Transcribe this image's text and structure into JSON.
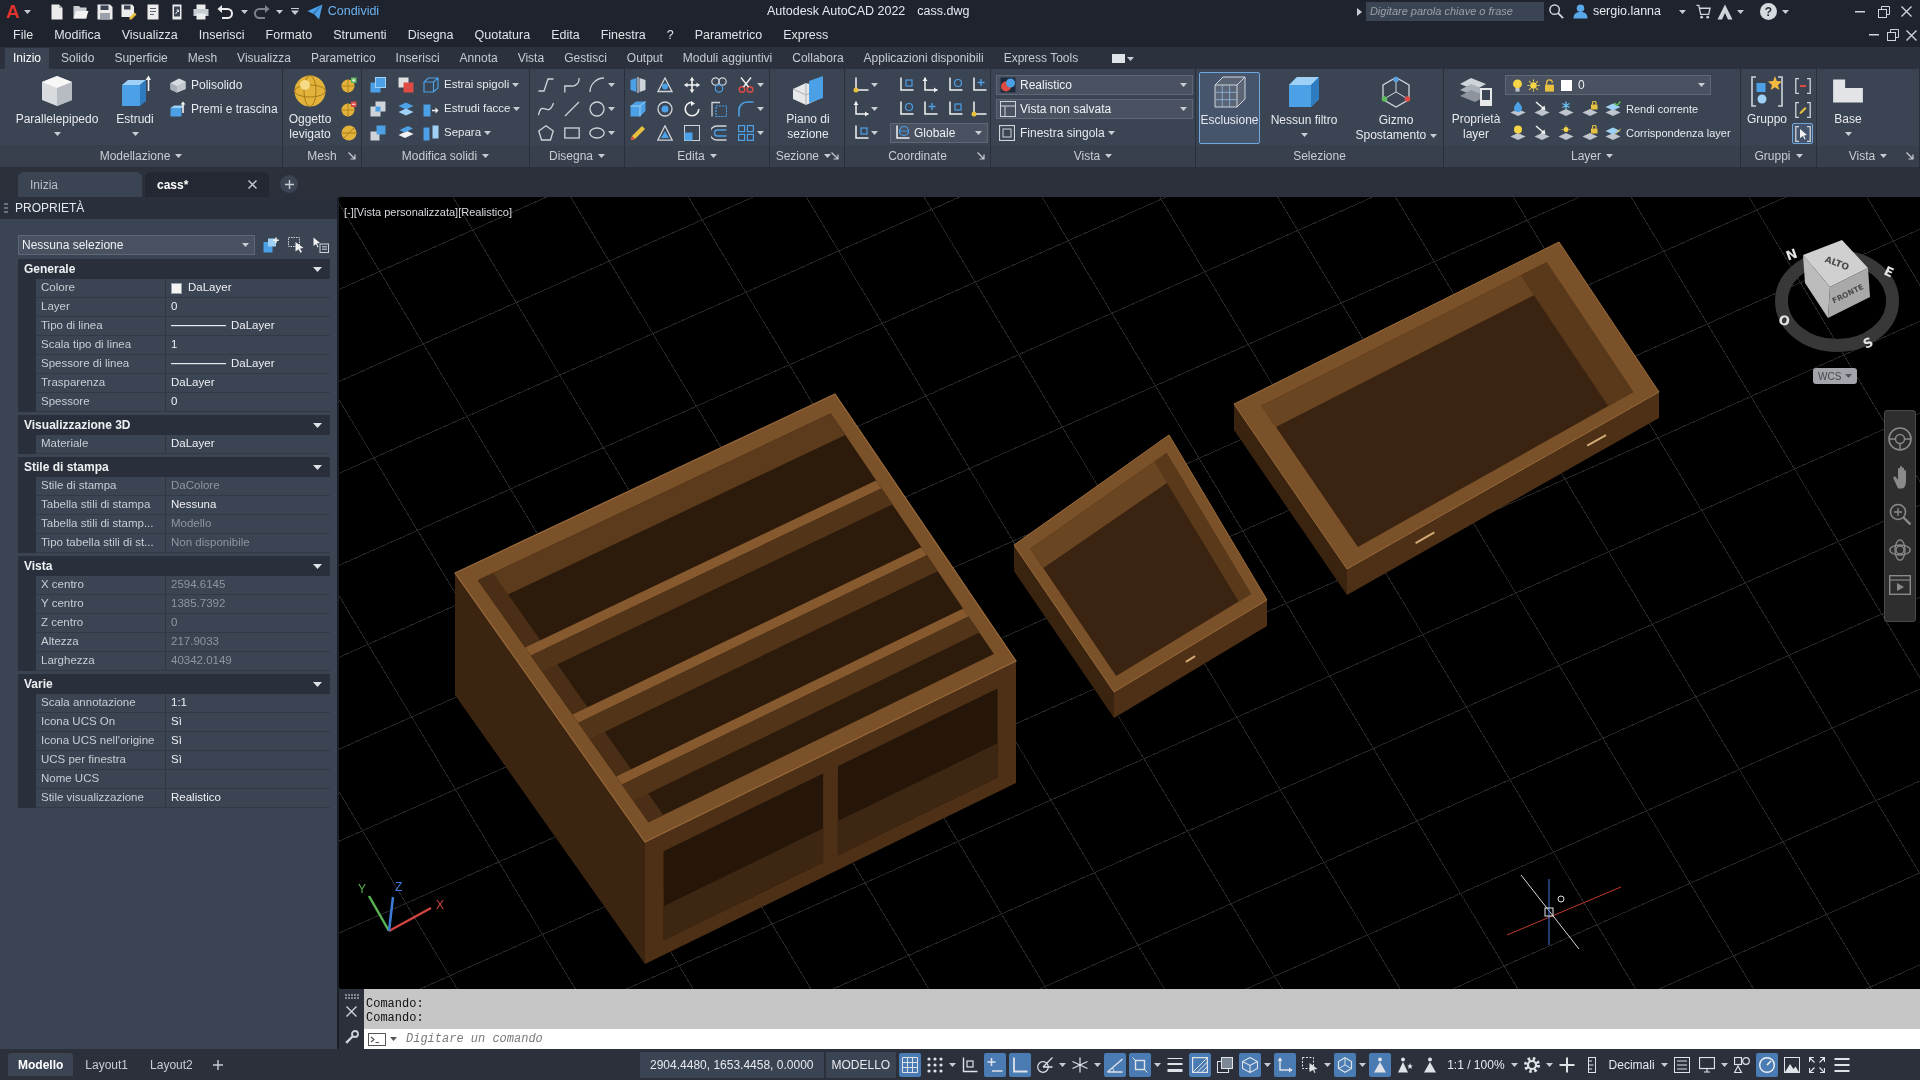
{
  "title_bar": {
    "logo": "A",
    "share": "Condividi",
    "title": "Autodesk AutoCAD 2022",
    "file": "cass.dwg",
    "search": {
      "placeholder": "Digitare parola chiave o frase"
    },
    "user": "sergio.lanna",
    "help": "?"
  },
  "menu_bar": [
    "File",
    "Modifica",
    "Visualizza",
    "Inserisci",
    "Formato",
    "Strumenti",
    "Disegna",
    "Quotatura",
    "Edita",
    "Finestra",
    "?",
    "Parametrico",
    "Express"
  ],
  "ribbon": {
    "tabs": [
      {
        "label": "Inizio",
        "selected": true
      },
      {
        "label": "Solido",
        "selected": false
      },
      {
        "label": "Superficie",
        "selected": false
      },
      {
        "label": "Mesh",
        "selected": false
      },
      {
        "label": "Visualizza",
        "selected": false
      },
      {
        "label": "Parametrico",
        "selected": false
      },
      {
        "label": "Inserisci",
        "selected": false
      },
      {
        "label": "Annota",
        "selected": false
      },
      {
        "label": "Vista",
        "selected": false
      },
      {
        "label": "Gestisci",
        "selected": false
      },
      {
        "label": "Output",
        "selected": false
      },
      {
        "label": "Moduli aggiuntivi",
        "selected": false
      },
      {
        "label": "Collabora",
        "selected": false
      },
      {
        "label": "Applicazioni disponibili",
        "selected": false
      },
      {
        "label": "Express Tools",
        "selected": false
      }
    ],
    "panels": [
      {
        "kind": "modeling",
        "title": "Modellazione",
        "menu": true,
        "launcher": false,
        "large": [
          {
            "label": "Parallelepipedo",
            "dropdown": true
          },
          {
            "label": "Estrudi",
            "dropdown": true
          }
        ],
        "small": [
          {
            "label": "Polisolido",
            "dropdown": false
          },
          {
            "label": "Premi e trascina",
            "dropdown": false
          }
        ]
      },
      {
        "kind": "mesh",
        "title": "Mesh",
        "menu": false,
        "launcher": true,
        "large": [
          {
            "label": "Oggetto levigato",
            "dropdown": false
          }
        ]
      },
      {
        "kind": "solid_edit",
        "title": "Modifica solidi",
        "menu": true,
        "launcher": false,
        "small": [
          {
            "label": "Estrai spigoli",
            "dropdown": true
          },
          {
            "label": "Estrudi facce",
            "dropdown": true
          },
          {
            "label": "Separa",
            "dropdown": true
          }
        ]
      },
      {
        "kind": "draw",
        "title": "Disegna",
        "menu": true,
        "launcher": false
      },
      {
        "kind": "modify",
        "title": "Edita",
        "menu": true,
        "launcher": false
      },
      {
        "kind": "section",
        "title": "Sezione",
        "menu": true,
        "launcher": true,
        "large": [
          {
            "label": "Piano di sezione",
            "dropdown": false
          }
        ]
      },
      {
        "kind": "coordinates",
        "title": "Coordinate",
        "menu": false,
        "launcher": true,
        "dropdowns": [
          {
            "value": "Globale"
          }
        ]
      },
      {
        "kind": "view",
        "title": "Vista",
        "menu": true,
        "launcher": false,
        "dropdowns": [
          {
            "value": "Realistico"
          },
          {
            "value": "Vista non salvata"
          }
        ],
        "small": [
          {
            "label": "Finestra singola",
            "dropdown": true
          }
        ]
      },
      {
        "kind": "selection",
        "title": "Selezione",
        "menu": false,
        "launcher": false,
        "large": [
          {
            "label": "Esclusione",
            "dropdown": false,
            "on": true
          },
          {
            "label": "Nessun filtro",
            "dropdown": true,
            "on": false
          },
          {
            "label": "Gizmo Spostamento",
            "dropdown": true,
            "on": false
          }
        ]
      },
      {
        "kind": "layers",
        "title": "Layer",
        "menu": true,
        "launcher": false,
        "large": [
          {
            "label": "Proprietà layer",
            "dropdown": false
          }
        ],
        "dropdowns": [
          {
            "value": "0"
          }
        ],
        "small": [
          {
            "label": "Rendi corrente",
            "dropdown": false
          },
          {
            "label": "Corrispondenza layer",
            "dropdown": false
          }
        ]
      },
      {
        "kind": "groups",
        "title": "Gruppi",
        "menu": true,
        "launcher": false,
        "large": [
          {
            "label": "Gruppo",
            "dropdown": false
          }
        ],
        "toggles": [
          {
            "on": false
          },
          {
            "on": false
          },
          {
            "on": true
          }
        ]
      },
      {
        "kind": "base",
        "title": "Vista",
        "menu": true,
        "launcher": true,
        "large": [
          {
            "label": "Base",
            "dropdown": true
          }
        ]
      }
    ]
  },
  "file_tabs": [
    {
      "label": "Inizia",
      "selected": false,
      "closable": false
    },
    {
      "label": "cass*",
      "selected": true,
      "closable": true
    }
  ],
  "properties": {
    "title": "PROPRIETÀ",
    "selection": "Nessuna selezione",
    "sections": [
      {
        "title": "Generale",
        "expanded": true,
        "rows": [
          {
            "label": "Colore",
            "value": "DaLayer",
            "kind": "swatch",
            "disabled": false
          },
          {
            "label": "Layer",
            "value": "0",
            "kind": "text",
            "disabled": false
          },
          {
            "label": "Tipo di linea",
            "value": "DaLayer",
            "kind": "linetype",
            "disabled": false
          },
          {
            "label": "Scala tipo di linea",
            "value": "1",
            "kind": "text",
            "disabled": false
          },
          {
            "label": "Spessore di linea",
            "value": "DaLayer",
            "kind": "linetype",
            "disabled": false
          },
          {
            "label": "Trasparenza",
            "value": "DaLayer",
            "kind": "text",
            "disabled": false
          },
          {
            "label": "Spessore",
            "value": "0",
            "kind": "text",
            "disabled": false
          }
        ]
      },
      {
        "title": "Visualizzazione 3D",
        "expanded": true,
        "rows": [
          {
            "label": "Materiale",
            "value": "DaLayer",
            "kind": "text",
            "disabled": false
          }
        ]
      },
      {
        "title": "Stile di stampa",
        "expanded": true,
        "rows": [
          {
            "label": "Stile di stampa",
            "value": "DaColore",
            "kind": "text",
            "disabled": true
          },
          {
            "label": "Tabella stili di stampa",
            "value": "Nessuna",
            "kind": "text",
            "disabled": false
          },
          {
            "label": "Tabella stili di stamp...",
            "value": "Modello",
            "kind": "text",
            "disabled": true
          },
          {
            "label": "Tipo tabella stili di st...",
            "value": "Non disponibile",
            "kind": "text",
            "disabled": true
          }
        ]
      },
      {
        "title": "Vista",
        "expanded": true,
        "rows": [
          {
            "label": "X centro",
            "value": "2594.6145",
            "kind": "text",
            "disabled": true
          },
          {
            "label": "Y centro",
            "value": "1385.7392",
            "kind": "text",
            "disabled": true
          },
          {
            "label": "Z centro",
            "value": "0",
            "kind": "text",
            "disabled": true
          },
          {
            "label": "Altezza",
            "value": "217.9033",
            "kind": "text",
            "disabled": true
          },
          {
            "label": "Larghezza",
            "value": "40342.0149",
            "kind": "text",
            "disabled": true
          }
        ]
      },
      {
        "title": "Varie",
        "expanded": true,
        "rows": [
          {
            "label": "Scala annotazione",
            "value": "1:1",
            "kind": "text",
            "disabled": false
          },
          {
            "label": "Icona UCS On",
            "value": "Sì",
            "kind": "text",
            "disabled": false
          },
          {
            "label": "Icona UCS nell'origine",
            "value": "Sì",
            "kind": "text",
            "disabled": false
          },
          {
            "label": "UCS per finestra",
            "value": "Sì",
            "kind": "text",
            "disabled": false
          },
          {
            "label": "Nome UCS",
            "kind": "text"
          },
          {
            "label": "Stile visualizzazione",
            "value": "Realistico",
            "kind": "text",
            "disabled": false
          }
        ]
      }
    ]
  },
  "viewport": {
    "controls": [
      "[-]",
      "[Vista personalizzata]",
      "[Realistico]"
    ],
    "viewcube": {
      "top": "ALTO",
      "front": "FRONTE",
      "compass": [
        "N",
        "E",
        "S",
        "O"
      ],
      "ucs": "WCS"
    },
    "ucs_axes": [
      {
        "label": "X",
        "color": "#d0453f"
      },
      {
        "label": "Y",
        "color": "#58b352"
      },
      {
        "label": "Z",
        "color": "#3d7bd9"
      }
    ]
  },
  "command_line": {
    "history": [
      "Comando:",
      "Comando:"
    ],
    "input": {
      "placeholder": "Digitare un comando"
    }
  },
  "status_bar": {
    "layout_tabs": [
      {
        "label": "Modello",
        "selected": true
      },
      {
        "label": "Layout1",
        "selected": false
      },
      {
        "label": "Layout2",
        "selected": false
      }
    ],
    "coordinates": "2904.4480, 1653.4458, 0.0000",
    "space": "MODELLO",
    "items": [
      {
        "kind": "toggle",
        "on": true,
        "dropdown": false
      },
      {
        "kind": "toggle",
        "on": false,
        "dropdown": true
      },
      {
        "kind": "toggle",
        "on": false,
        "dropdown": false
      },
      {
        "kind": "toggle",
        "on": true,
        "dropdown": false
      },
      {
        "kind": "toggle",
        "on": true,
        "dropdown": false
      },
      {
        "kind": "toggle",
        "on": false,
        "dropdown": true
      },
      {
        "kind": "toggle",
        "on": false,
        "dropdown": true
      },
      {
        "kind": "toggle",
        "on": true,
        "dropdown": false
      },
      {
        "kind": "toggle",
        "on": true,
        "dropdown": true
      },
      {
        "kind": "toggle",
        "on": false,
        "dropdown": false
      },
      {
        "kind": "toggle",
        "on": true,
        "dropdown": false
      },
      {
        "kind": "toggle",
        "on": false,
        "dropdown": false
      },
      {
        "kind": "toggle",
        "on": true,
        "dropdown": true
      },
      {
        "kind": "toggle",
        "on": true,
        "dropdown": false
      },
      {
        "kind": "toggle",
        "on": false,
        "dropdown": true
      },
      {
        "kind": "toggle",
        "on": true,
        "dropdown": true
      },
      {
        "kind": "toggle",
        "on": true,
        "dropdown": false
      },
      {
        "kind": "toggle",
        "on": false,
        "dropdown": false
      },
      {
        "kind": "toggle",
        "on": false,
        "dropdown": false
      },
      {
        "kind": "text",
        "text": "1:1 / 100%",
        "dropdown": true
      },
      {
        "kind": "toggle",
        "on": false,
        "dropdown": true
      },
      {
        "kind": "toggle",
        "on": false,
        "dropdown": false
      },
      {
        "kind": "toggle",
        "on": false,
        "dropdown": false
      },
      {
        "kind": "text",
        "text": "Decimali",
        "dropdown": true
      },
      {
        "kind": "toggle",
        "on": false,
        "dropdown": false
      },
      {
        "kind": "toggle",
        "on": false,
        "dropdown": true
      },
      {
        "kind": "toggle",
        "on": false,
        "dropdown": false
      },
      {
        "kind": "toggle",
        "on": true,
        "dropdown": false
      },
      {
        "kind": "toggle",
        "on": false,
        "dropdown": false
      },
      {
        "kind": "toggle",
        "on": false,
        "dropdown": false
      },
      {
        "kind": "toggle",
        "on": false,
        "dropdown": false
      }
    ]
  }
}
